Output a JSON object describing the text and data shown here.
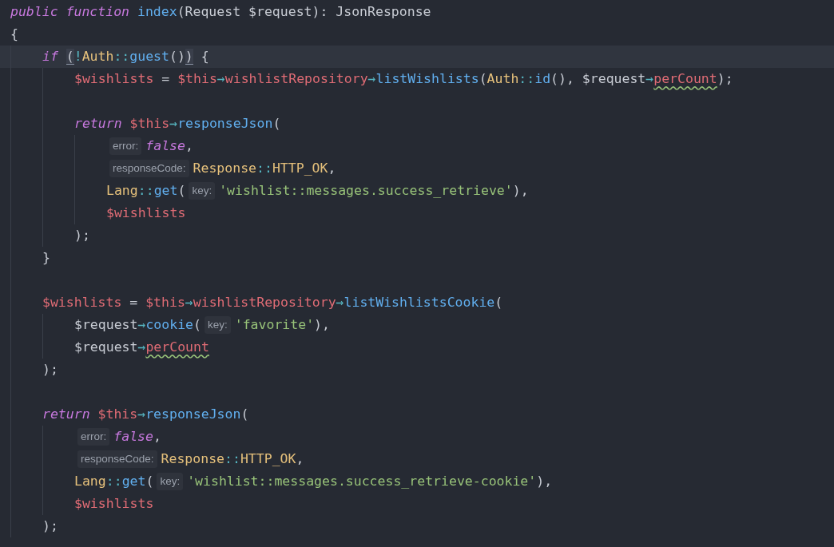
{
  "editor": {
    "lines": [
      {
        "kind": "code",
        "tokens": [
          {
            "kind": "kw",
            "text": "public "
          },
          {
            "kind": "kw",
            "text": "function "
          },
          {
            "kind": "fn",
            "text": "index"
          },
          {
            "kind": "plain",
            "text": "(Request $request): JsonResponse"
          }
        ]
      },
      {
        "kind": "code",
        "tokens": [
          {
            "kind": "plain",
            "text": "{"
          }
        ],
        "children": [
          {
            "kind": "code",
            "current": true,
            "tokens": [
              {
                "kind": "kw",
                "text": "if "
              },
              {
                "kind": "plain",
                "text": "(",
                "matched": true
              },
              {
                "kind": "op",
                "text": "!"
              },
              {
                "kind": "cls",
                "text": "Auth"
              },
              {
                "kind": "op",
                "text": "::"
              },
              {
                "kind": "fn",
                "text": "guest"
              },
              {
                "kind": "plain",
                "text": "()"
              },
              {
                "kind": "plain",
                "text": ")",
                "matched": true
              },
              {
                "kind": "plain",
                "text": " {"
              }
            ],
            "children": [
              {
                "kind": "code",
                "tokens": [
                  {
                    "kind": "var",
                    "text": "$wishlists"
                  },
                  {
                    "kind": "plain",
                    "text": " = "
                  },
                  {
                    "kind": "var",
                    "text": "$this"
                  },
                  {
                    "kind": "op",
                    "text": "→"
                  },
                  {
                    "kind": "var",
                    "text": "wishlistRepository"
                  },
                  {
                    "kind": "op",
                    "text": "→"
                  },
                  {
                    "kind": "fn",
                    "text": "listWishlists"
                  },
                  {
                    "kind": "plain",
                    "text": "("
                  },
                  {
                    "kind": "cls",
                    "text": "Auth"
                  },
                  {
                    "kind": "op",
                    "text": "::"
                  },
                  {
                    "kind": "fn",
                    "text": "id"
                  },
                  {
                    "kind": "plain",
                    "text": "(), $request"
                  },
                  {
                    "kind": "op",
                    "text": "→"
                  },
                  {
                    "kind": "var",
                    "text": "perCount",
                    "squiggle": true
                  },
                  {
                    "kind": "plain",
                    "text": ");"
                  }
                ]
              },
              {
                "kind": "blank"
              },
              {
                "kind": "code",
                "tokens": [
                  {
                    "kind": "kw",
                    "text": "return "
                  },
                  {
                    "kind": "var",
                    "text": "$this"
                  },
                  {
                    "kind": "op",
                    "text": "→"
                  },
                  {
                    "kind": "fn",
                    "text": "responseJson"
                  },
                  {
                    "kind": "plain",
                    "text": "("
                  }
                ],
                "children": [
                  {
                    "kind": "code",
                    "tokens": [
                      {
                        "kind": "hint",
                        "text": "error:"
                      },
                      {
                        "kind": "kw",
                        "text": "false"
                      },
                      {
                        "kind": "plain",
                        "text": ","
                      }
                    ]
                  },
                  {
                    "kind": "code",
                    "tokens": [
                      {
                        "kind": "hint",
                        "text": "responseCode:"
                      },
                      {
                        "kind": "cls",
                        "text": "Response"
                      },
                      {
                        "kind": "op",
                        "text": "::"
                      },
                      {
                        "kind": "cls",
                        "text": "HTTP_OK"
                      },
                      {
                        "kind": "plain",
                        "text": ","
                      }
                    ]
                  },
                  {
                    "kind": "code",
                    "tokens": [
                      {
                        "kind": "cls",
                        "text": "Lang"
                      },
                      {
                        "kind": "op",
                        "text": "::"
                      },
                      {
                        "kind": "fn",
                        "text": "get"
                      },
                      {
                        "kind": "plain",
                        "text": "("
                      },
                      {
                        "kind": "hint",
                        "text": "key:"
                      },
                      {
                        "kind": "str",
                        "text": "'wishlist::messages.success_retrieve'"
                      },
                      {
                        "kind": "plain",
                        "text": "),"
                      }
                    ]
                  },
                  {
                    "kind": "code",
                    "tokens": [
                      {
                        "kind": "var",
                        "text": "$wishlists"
                      }
                    ]
                  }
                ]
              },
              {
                "kind": "code",
                "tokens": [
                  {
                    "kind": "plain",
                    "text": ");"
                  }
                ]
              }
            ]
          },
          {
            "kind": "code",
            "tokens": [
              {
                "kind": "plain",
                "text": "}"
              }
            ]
          },
          {
            "kind": "blank"
          },
          {
            "kind": "code",
            "tokens": [
              {
                "kind": "var",
                "text": "$wishlists"
              },
              {
                "kind": "plain",
                "text": " = "
              },
              {
                "kind": "var",
                "text": "$this"
              },
              {
                "kind": "op",
                "text": "→"
              },
              {
                "kind": "var",
                "text": "wishlistRepository"
              },
              {
                "kind": "op",
                "text": "→"
              },
              {
                "kind": "fn",
                "text": "listWishlistsCookie"
              },
              {
                "kind": "plain",
                "text": "("
              }
            ],
            "children": [
              {
                "kind": "code",
                "tokens": [
                  {
                    "kind": "plain",
                    "text": "$request"
                  },
                  {
                    "kind": "op",
                    "text": "→"
                  },
                  {
                    "kind": "fn",
                    "text": "cookie"
                  },
                  {
                    "kind": "plain",
                    "text": "("
                  },
                  {
                    "kind": "hint",
                    "text": "key:"
                  },
                  {
                    "kind": "str",
                    "text": "'favorite'"
                  },
                  {
                    "kind": "plain",
                    "text": "),"
                  }
                ]
              },
              {
                "kind": "code",
                "tokens": [
                  {
                    "kind": "plain",
                    "text": "$request"
                  },
                  {
                    "kind": "op",
                    "text": "→"
                  },
                  {
                    "kind": "var",
                    "text": "perCount",
                    "squiggle": true
                  }
                ]
              }
            ]
          },
          {
            "kind": "code",
            "tokens": [
              {
                "kind": "plain",
                "text": ");"
              }
            ]
          },
          {
            "kind": "blank"
          },
          {
            "kind": "code",
            "tokens": [
              {
                "kind": "kw",
                "text": "return "
              },
              {
                "kind": "var",
                "text": "$this"
              },
              {
                "kind": "op",
                "text": "→"
              },
              {
                "kind": "fn",
                "text": "responseJson"
              },
              {
                "kind": "plain",
                "text": "("
              }
            ],
            "children": [
              {
                "kind": "code",
                "tokens": [
                  {
                    "kind": "hint",
                    "text": "error:"
                  },
                  {
                    "kind": "kw",
                    "text": "false"
                  },
                  {
                    "kind": "plain",
                    "text": ","
                  }
                ]
              },
              {
                "kind": "code",
                "tokens": [
                  {
                    "kind": "hint",
                    "text": "responseCode:"
                  },
                  {
                    "kind": "cls",
                    "text": "Response"
                  },
                  {
                    "kind": "op",
                    "text": "::"
                  },
                  {
                    "kind": "cls",
                    "text": "HTTP_OK"
                  },
                  {
                    "kind": "plain",
                    "text": ","
                  }
                ]
              },
              {
                "kind": "code",
                "tokens": [
                  {
                    "kind": "cls",
                    "text": "Lang"
                  },
                  {
                    "kind": "op",
                    "text": "::"
                  },
                  {
                    "kind": "fn",
                    "text": "get"
                  },
                  {
                    "kind": "plain",
                    "text": "("
                  },
                  {
                    "kind": "hint",
                    "text": "key:"
                  },
                  {
                    "kind": "str",
                    "text": "'wishlist::messages.success_retrieve-cookie'"
                  },
                  {
                    "kind": "plain",
                    "text": "),"
                  }
                ]
              },
              {
                "kind": "code",
                "tokens": [
                  {
                    "kind": "var",
                    "text": "$wishlists"
                  }
                ]
              }
            ]
          },
          {
            "kind": "code",
            "tokens": [
              {
                "kind": "plain",
                "text": ");"
              }
            ]
          }
        ]
      }
    ]
  }
}
